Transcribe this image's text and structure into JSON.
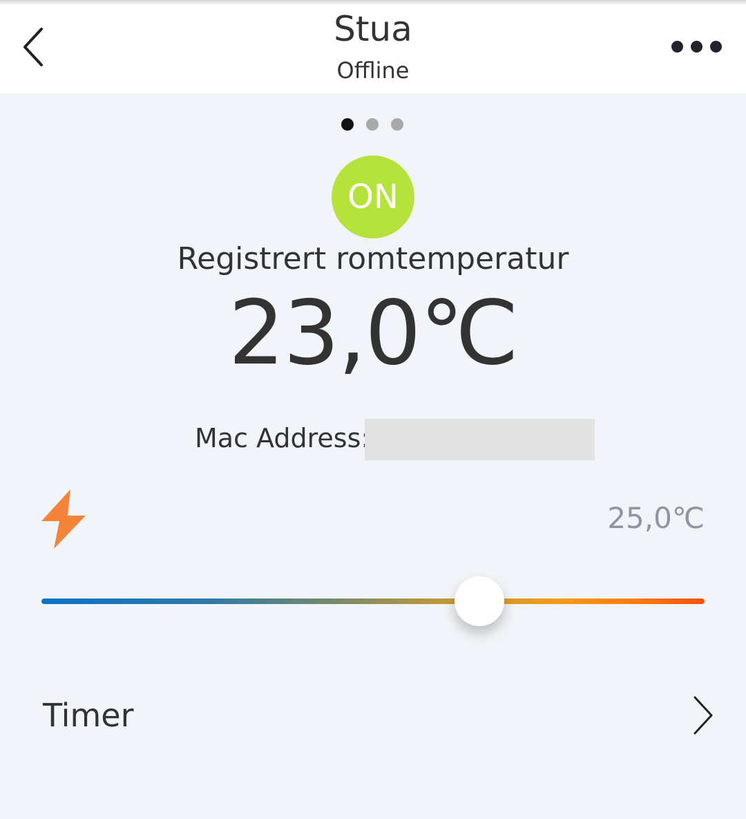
{
  "header": {
    "title": "Stua",
    "status": "Offline"
  },
  "icons": {
    "back": "chevron-left-icon",
    "more": "more-dots-icon",
    "mode": "lightning-bolt-icon",
    "timer": "chevron-right-icon"
  },
  "pager": {
    "pages": 3,
    "active_page": 1
  },
  "power": {
    "label": "ON",
    "color": "#b5e33b"
  },
  "room": {
    "label": "Registrert romtemperatur",
    "temperature": "23,0℃"
  },
  "device": {
    "mac_label": "Mac Address:",
    "mac_value": ""
  },
  "setpoint": {
    "display": "25,0℃",
    "slider_position_fraction": 0.66,
    "mode_color": "#f5843a"
  },
  "timer": {
    "label": "Timer"
  },
  "colors": {
    "background": "#f1f4f8",
    "slider_cold": "#0a72c8",
    "slider_hot": "#ff4f0a"
  }
}
